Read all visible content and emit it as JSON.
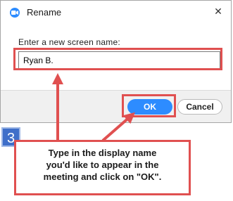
{
  "dialog": {
    "title": "Rename",
    "close_label": "✕",
    "prompt": "Enter a new screen name:",
    "name_value": "Ryan B.",
    "ok_label": "OK",
    "cancel_label": "Cancel"
  },
  "annotation": {
    "step_number": "3",
    "lines": [
      "Type in the display name",
      "you'd like to appear in the",
      "meeting and click on \"OK\"."
    ]
  },
  "colors": {
    "accent": "#2d8cff",
    "highlight": "#e05050",
    "step_badge": "#3f6fc9"
  },
  "icons": {
    "app": "zoom-app-icon",
    "close": "close-icon"
  }
}
